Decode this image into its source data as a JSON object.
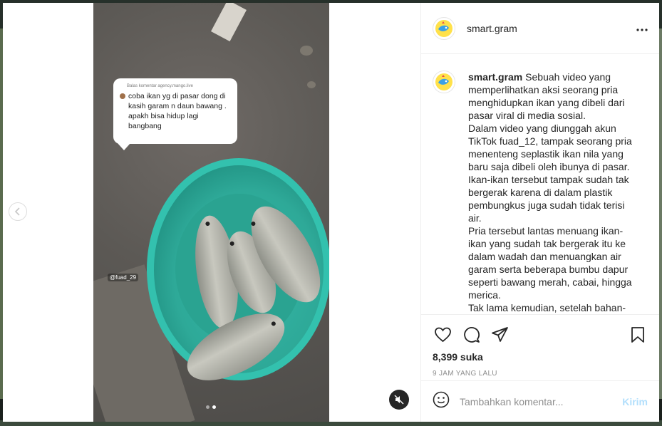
{
  "header": {
    "username": "smart.gram",
    "more_icon": "more-horizontal-icon"
  },
  "video_overlay": {
    "comment_reply_header": "Balas komentar agency.mango.live",
    "comment_text": "coba ikan yg di pasar dong di kasih garam n daun bawang . apakh bisa hidup lagi bangbang",
    "watermark": "@fuad_29"
  },
  "caption": {
    "username": "smart.gram",
    "paragraphs": [
      "Sebuah video yang memperlihatkan aksi seorang pria menghidupkan ikan yang dibeli dari pasar viral di media sosial.",
      "Dalam video yang diunggah akun TikTok fuad_12, tampak seorang pria menenteng seplastik ikan nila yang baru saja dibeli oleh ibunya di pasar.",
      "Ikan-ikan tersebut tampak sudah tak bergerak karena di dalam plastik pembungkus juga sudah tidak terisi air.",
      "Pria tersebut lantas menuang ikan-ikan yang sudah tak bergerak itu ke dalam wadah dan menuangkan air garam serta beberapa bumbu dapur seperti bawang merah, cabai, hingga merica.",
      "Tak lama kemudian, setelah bahan-"
    ]
  },
  "actions": {
    "likes": "8,399 suka",
    "timestamp": "9 JAM YANG LALU"
  },
  "comment": {
    "placeholder": "Tambahkan komentar...",
    "post_label": "Kirim"
  },
  "carousel": {
    "count": 2,
    "active": 2
  },
  "colors": {
    "accent_disabled": "#b2dffc",
    "text": "#262626",
    "muted": "#8e8e8e"
  }
}
